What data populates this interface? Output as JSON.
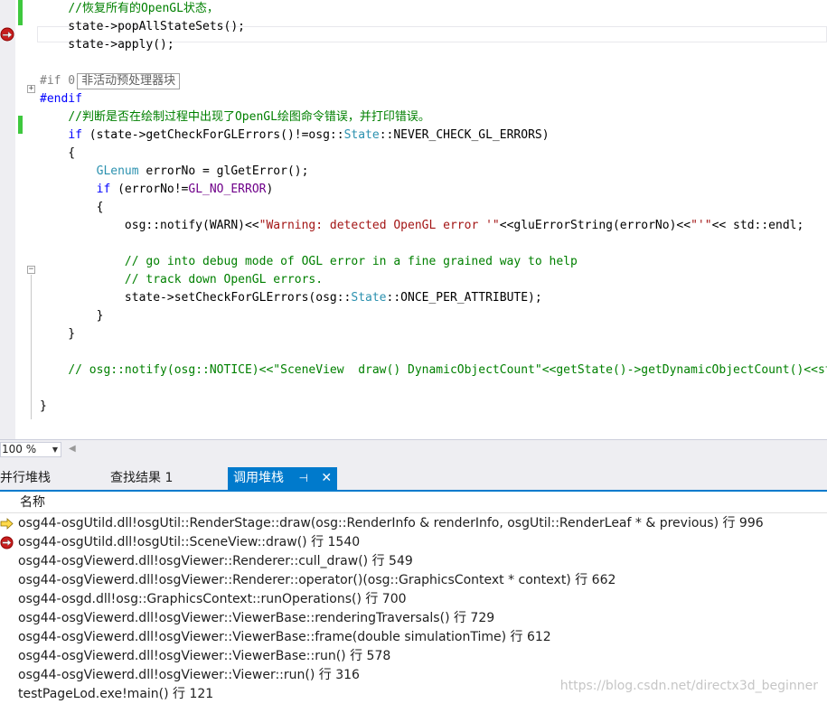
{
  "editor": {
    "lines": [
      {
        "tokens": [
          {
            "t": "    "
          },
          {
            "t": "//恢复所有的OpenGL状态，",
            "c": "comment"
          }
        ]
      },
      {
        "tokens": [
          {
            "t": "    state->popAllStateSets();"
          }
        ]
      },
      {
        "tokens": [
          {
            "t": "    state->apply();"
          }
        ]
      },
      {
        "tokens": [
          {
            "t": ""
          }
        ]
      },
      {
        "tokens": [
          {
            "t": "#if 0",
            "c": "pre"
          }
        ]
      },
      {
        "tokens": [
          {
            "t": "#endif",
            "c": "kw"
          }
        ]
      },
      {
        "tokens": [
          {
            "t": "    "
          },
          {
            "t": "//判断是否在绘制过程中出现了OpenGL绘图命令错误，并打印错误。",
            "c": "comment"
          }
        ]
      },
      {
        "tokens": [
          {
            "t": "    "
          },
          {
            "t": "if",
            "c": "kw"
          },
          {
            "t": " (state->getCheckForGLErrors()!=osg::"
          },
          {
            "t": "State",
            "c": "type"
          },
          {
            "t": "::NEVER_CHECK_GL_ERRORS)"
          }
        ]
      },
      {
        "tokens": [
          {
            "t": "    {"
          }
        ]
      },
      {
        "tokens": [
          {
            "t": "        "
          },
          {
            "t": "GLenum",
            "c": "type"
          },
          {
            "t": " errorNo = glGetError();"
          }
        ]
      },
      {
        "tokens": [
          {
            "t": "        "
          },
          {
            "t": "if",
            "c": "kw"
          },
          {
            "t": " (errorNo!="
          },
          {
            "t": "GL_NO_ERROR",
            "c": "macro"
          },
          {
            "t": ")"
          }
        ]
      },
      {
        "tokens": [
          {
            "t": "        {"
          }
        ]
      },
      {
        "tokens": [
          {
            "t": "            osg::notify(WARN)<<"
          },
          {
            "t": "\"Warning: detected OpenGL error '\"",
            "c": "str"
          },
          {
            "t": "<<gluErrorString(errorNo)<<"
          },
          {
            "t": "\"'\"",
            "c": "str"
          },
          {
            "t": "<< std::endl;"
          }
        ]
      },
      {
        "tokens": [
          {
            "t": ""
          }
        ]
      },
      {
        "tokens": [
          {
            "t": "            "
          },
          {
            "t": "// go into debug mode of OGL error in a fine grained way to help",
            "c": "comment"
          }
        ]
      },
      {
        "tokens": [
          {
            "t": "            "
          },
          {
            "t": "// track down OpenGL errors.",
            "c": "comment"
          }
        ]
      },
      {
        "tokens": [
          {
            "t": "            state->setCheckForGLErrors(osg::"
          },
          {
            "t": "State",
            "c": "type"
          },
          {
            "t": "::ONCE_PER_ATTRIBUTE);"
          }
        ]
      },
      {
        "tokens": [
          {
            "t": "        }"
          }
        ]
      },
      {
        "tokens": [
          {
            "t": "    }"
          }
        ]
      },
      {
        "tokens": [
          {
            "t": ""
          }
        ]
      },
      {
        "tokens": [
          {
            "t": "    "
          },
          {
            "t": "// osg::notify(osg::NOTICE)<<\"SceneView  draw() DynamicObjectCount\"<<getState()->getDynamicObjectCount()<<std::endl;",
            "c": "comment"
          }
        ]
      },
      {
        "tokens": [
          {
            "t": ""
          }
        ]
      },
      {
        "tokens": [
          {
            "t": "}"
          }
        ]
      }
    ],
    "inactive_block_label": "非活动预处理器块",
    "colors": {
      "comment": "#008000",
      "keyword": "#0000ff",
      "type": "#2b91af",
      "macro": "#6f008a",
      "string": "#a31515"
    }
  },
  "zoom": {
    "value": "100 %"
  },
  "tabs": [
    {
      "label": "并行堆栈"
    },
    {
      "label": "查找结果 1"
    },
    {
      "label": "调用堆栈",
      "active": true
    }
  ],
  "callstack": {
    "header": "名称",
    "frames": [
      {
        "text": "osg44-osgUtild.dll!osgUtil::RenderStage::draw(osg::RenderInfo & renderInfo, osgUtil::RenderLeaf * & previous) 行 996",
        "icon": "current-frame-arrow-icon"
      },
      {
        "text": "osg44-osgUtild.dll!osgUtil::SceneView::draw() 行 1540",
        "icon": "breakpoint-icon"
      },
      {
        "text": "osg44-osgViewerd.dll!osgViewer::Renderer::cull_draw() 行 549"
      },
      {
        "text": "osg44-osgViewerd.dll!osgViewer::Renderer::operator()(osg::GraphicsContext * context) 行 662"
      },
      {
        "text": "osg44-osgd.dll!osg::GraphicsContext::runOperations() 行 700"
      },
      {
        "text": "osg44-osgViewerd.dll!osgViewer::ViewerBase::renderingTraversals() 行 729"
      },
      {
        "text": "osg44-osgViewerd.dll!osgViewer::ViewerBase::frame(double simulationTime) 行 612"
      },
      {
        "text": "osg44-osgViewerd.dll!osgViewer::ViewerBase::run() 行 578"
      },
      {
        "text": "osg44-osgViewerd.dll!osgViewer::Viewer::run() 行 316"
      },
      {
        "text": "testPageLod.exe!main() 行 121"
      }
    ]
  },
  "watermark": "https://blog.csdn.net/directx3d_beginner"
}
